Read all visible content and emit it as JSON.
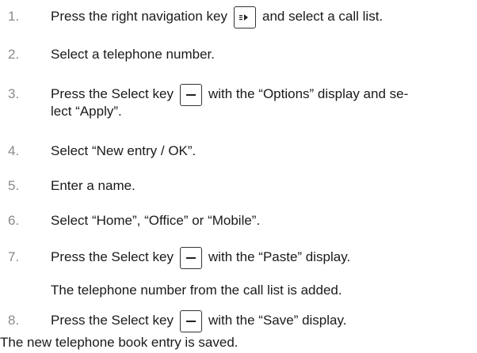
{
  "steps": [
    {
      "num": "1.",
      "before": "Press the right navigation key",
      "after": "and select a call list."
    },
    {
      "num": "2.",
      "text": "Select a telephone number."
    },
    {
      "num": "3.",
      "before": "Press the Select key",
      "after": "with the “Options” display and se-",
      "line2": "lect “Apply”."
    },
    {
      "num": "4.",
      "text": "Select “New entry / OK”."
    },
    {
      "num": "5.",
      "text": "Enter a name."
    },
    {
      "num": "6.",
      "text": "Select “Home”, “Office” or “Mobile”."
    },
    {
      "num": "7.",
      "before": "Press the Select key",
      "after": "with the “Paste” display.",
      "sub": "The telephone number from the call list is added."
    },
    {
      "num": "8.",
      "before": "Press the Select key",
      "after": "with the “Save” display."
    }
  ],
  "result": "The new telephone book entry is saved.",
  "icons": {
    "nav_key": "right-navigation-key-icon",
    "select_key": "select-key-icon"
  }
}
